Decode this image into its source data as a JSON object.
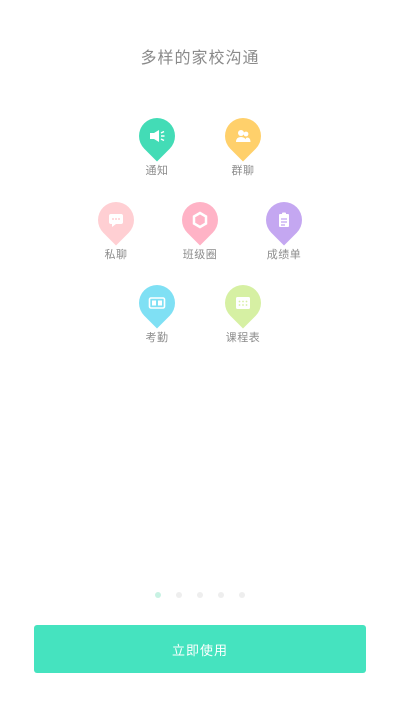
{
  "page": {
    "title": "多样的家校沟通"
  },
  "features": [
    {
      "label": "通知",
      "icon": "megaphone-icon",
      "color": "#43dcb6"
    },
    {
      "label": "群聊",
      "icon": "group-icon",
      "color": "#ffd06b"
    },
    {
      "label": "私聊",
      "icon": "chat-bubble-icon",
      "color": "#ffcfd3"
    },
    {
      "label": "班级圈",
      "icon": "hexagon-icon",
      "color": "#ffb3c6"
    },
    {
      "label": "成绩单",
      "icon": "clipboard-icon",
      "color": "#c4a7f1"
    },
    {
      "label": "考勤",
      "icon": "clock-display-icon",
      "color": "#7fe0f4"
    },
    {
      "label": "课程表",
      "icon": "calendar-grid-icon",
      "color": "#d6f0a3"
    }
  ],
  "pager": {
    "count": 5,
    "active_index": 0,
    "active_color": "#c8f2e3",
    "inactive_color": "#eeeeee"
  },
  "cta": {
    "label": "立即使用",
    "color": "#45e3bf"
  }
}
